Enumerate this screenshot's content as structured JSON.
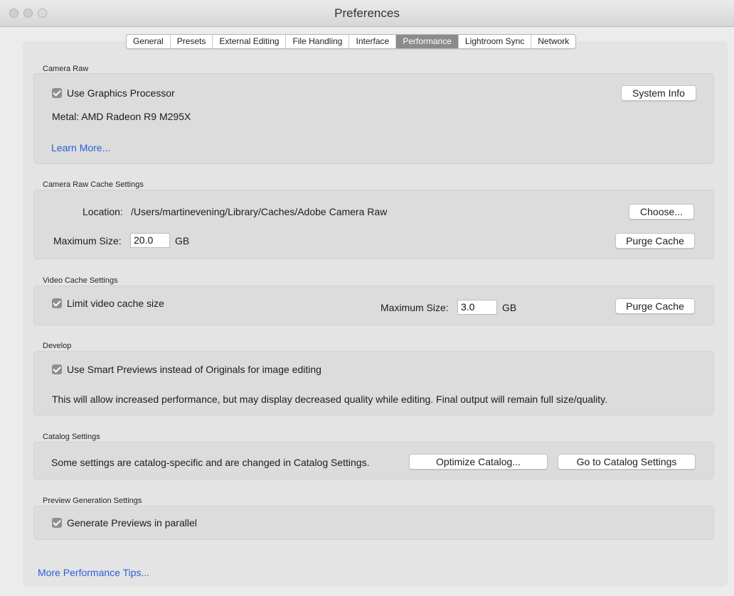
{
  "window": {
    "title": "Preferences"
  },
  "tabs": [
    {
      "label": "General"
    },
    {
      "label": "Presets"
    },
    {
      "label": "External Editing"
    },
    {
      "label": "File Handling"
    },
    {
      "label": "Interface"
    },
    {
      "label": "Performance"
    },
    {
      "label": "Lightroom Sync"
    },
    {
      "label": "Network"
    }
  ],
  "active_tab": "Performance",
  "camera_raw": {
    "section_title": "Camera Raw",
    "use_gpu_label": "Use Graphics Processor",
    "use_gpu_checked": true,
    "system_info_button": "System Info",
    "metal_info": "Metal: AMD Radeon R9 M295X",
    "learn_more_link": "Learn More..."
  },
  "cache_settings": {
    "section_title": "Camera Raw Cache Settings",
    "location_label": "Location:",
    "location_value": "/Users/martinevening/Library/Caches/Adobe Camera Raw",
    "choose_button": "Choose...",
    "max_size_label": "Maximum Size:",
    "max_size_value": "20.0",
    "unit": "GB",
    "purge_button": "Purge Cache"
  },
  "video_cache": {
    "section_title": "Video Cache Settings",
    "limit_label": "Limit video cache size",
    "limit_checked": true,
    "max_size_label": "Maximum Size:",
    "max_size_value": "3.0",
    "unit": "GB",
    "purge_button": "Purge Cache"
  },
  "develop": {
    "section_title": "Develop",
    "smart_previews_label": "Use Smart Previews instead of Originals for image editing",
    "smart_previews_checked": true,
    "note": "This will allow increased performance, but may display decreased quality while editing. Final output will remain full size/quality."
  },
  "catalog": {
    "section_title": "Catalog Settings",
    "note": "Some settings are catalog-specific and are changed in Catalog Settings.",
    "optimize_button": "Optimize Catalog...",
    "goto_button": "Go to Catalog Settings"
  },
  "preview_generation": {
    "section_title": "Preview Generation Settings",
    "parallel_label": "Generate Previews in parallel",
    "parallel_checked": true
  },
  "footer": {
    "tips_link": "More Performance Tips..."
  }
}
